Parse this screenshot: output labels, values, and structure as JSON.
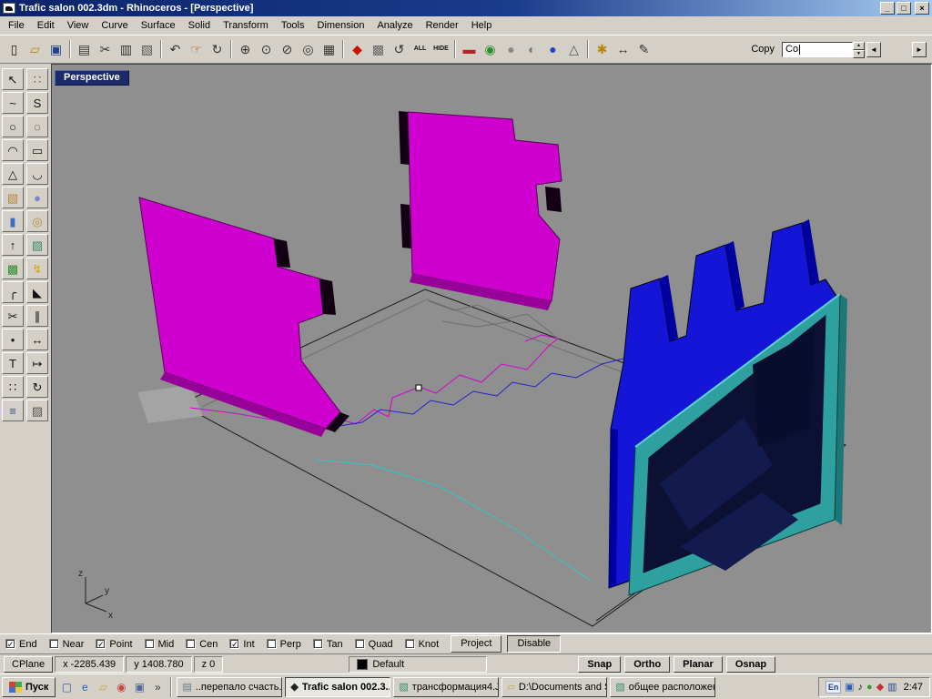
{
  "window": {
    "title": "Trafic salon 002.3dm - Rhinoceros - [Perspective]",
    "controls": {
      "minimize": "_",
      "maximize": "□",
      "close": "×"
    }
  },
  "menu": {
    "items": [
      "File",
      "Edit",
      "View",
      "Curve",
      "Surface",
      "Solid",
      "Transform",
      "Tools",
      "Dimension",
      "Analyze",
      "Render",
      "Help"
    ]
  },
  "toolbar": {
    "command_history": "Copy",
    "command_input": "Co",
    "spinner_up": "▲",
    "spinner_down": "▼",
    "prev_arrow": "◄",
    "next_arrow": "►",
    "icons": [
      {
        "name": "new-file-icon",
        "glyph": "▯",
        "color": "#222222"
      },
      {
        "name": "open-file-icon",
        "glyph": "▱",
        "color": "#b8860b"
      },
      {
        "name": "save-file-icon",
        "glyph": "▣",
        "color": "#27408b"
      },
      {
        "sep": true
      },
      {
        "name": "print-icon",
        "glyph": "▤",
        "color": "#333333"
      },
      {
        "name": "cut-icon",
        "glyph": "✂",
        "color": "#333333"
      },
      {
        "name": "copy-icon",
        "glyph": "▥",
        "color": "#333333"
      },
      {
        "name": "paste-icon",
        "glyph": "▧",
        "color": "#555555"
      },
      {
        "sep": true
      },
      {
        "name": "undo-icon",
        "glyph": "↶",
        "color": "#333333"
      },
      {
        "name": "pan-icon",
        "glyph": "☞",
        "color": "#a0622a"
      },
      {
        "name": "rotate-view-icon",
        "glyph": "↻",
        "color": "#333333"
      },
      {
        "sep": true
      },
      {
        "name": "zoom-in-icon",
        "glyph": "⊕",
        "color": "#333333"
      },
      {
        "name": "zoom-window-icon",
        "glyph": "⊙",
        "color": "#333333"
      },
      {
        "name": "zoom-dynamic-icon",
        "glyph": "⊘",
        "color": "#333333"
      },
      {
        "name": "zoom-extents-icon",
        "glyph": "◎",
        "color": "#333333"
      },
      {
        "name": "grid-icon",
        "glyph": "▦",
        "color": "#333333"
      },
      {
        "sep": true
      },
      {
        "name": "render-icon",
        "glyph": "◆",
        "color": "#cc1100"
      },
      {
        "name": "shade-icon",
        "glyph": "▩",
        "color": "#666666"
      },
      {
        "name": "spin-view-icon",
        "glyph": "↺",
        "color": "#333333"
      },
      {
        "name": "show-all-icon",
        "glyph": "ALL",
        "color": "#111111"
      },
      {
        "name": "hide-icon",
        "glyph": "HIDE",
        "color": "#111111"
      },
      {
        "sep": true
      },
      {
        "name": "render-settings-icon",
        "glyph": "▬",
        "color": "#bb2222"
      },
      {
        "name": "color-wheel-icon",
        "glyph": "◉",
        "color": "#2a8f2a"
      },
      {
        "name": "sphere-gray-icon",
        "glyph": "●",
        "color": "#8a8a8a"
      },
      {
        "name": "sphere-shaded-icon",
        "glyph": "◐",
        "color": "#777777"
      },
      {
        "name": "sphere-blue-icon",
        "glyph": "●",
        "color": "#2244cc"
      },
      {
        "name": "spotlight-icon",
        "glyph": "△",
        "color": "#555555"
      },
      {
        "sep": true
      },
      {
        "name": "options-icon",
        "glyph": "✱",
        "color": "#b8860b"
      },
      {
        "name": "measure-icon",
        "glyph": "↔",
        "color": "#333333"
      },
      {
        "name": "annotate-icon",
        "glyph": "✎",
        "color": "#333333"
      }
    ]
  },
  "sidebar": {
    "icons": [
      {
        "name": "selection-arrow-icon",
        "glyph": "↖",
        "color": "#111111"
      },
      {
        "name": "grip-dots-icon",
        "glyph": "∷",
        "color": "#555555"
      },
      {
        "name": "control-point-curve-icon",
        "glyph": "~",
        "color": "#111111"
      },
      {
        "name": "interpolate-curve-icon",
        "glyph": "S",
        "color": "#111111"
      },
      {
        "name": "circle-icon",
        "glyph": "○",
        "color": "#111111"
      },
      {
        "name": "ellipse-icon",
        "glyph": "◌",
        "color": "#111111"
      },
      {
        "name": "arc-icon",
        "glyph": "◠",
        "color": "#111111"
      },
      {
        "name": "rectangle-icon",
        "glyph": "▭",
        "color": "#111111"
      },
      {
        "name": "polygon-icon",
        "glyph": "△",
        "color": "#111111"
      },
      {
        "name": "freeform-curve-icon",
        "glyph": "◡",
        "color": "#111111"
      },
      {
        "name": "box-icon",
        "glyph": "▧",
        "color": "#b58a3a"
      },
      {
        "name": "sphere-icon",
        "glyph": "●",
        "color": "#7a86c8"
      },
      {
        "name": "cylinder-icon",
        "glyph": "▮",
        "color": "#3a6fc0"
      },
      {
        "name": "torus-icon",
        "glyph": "◎",
        "color": "#b58a3a"
      },
      {
        "name": "extrude-icon",
        "glyph": "↑",
        "color": "#111111"
      },
      {
        "name": "surface-icon",
        "glyph": "▨",
        "color": "#3a8a6a"
      },
      {
        "name": "planar-surface-icon",
        "glyph": "▩",
        "color": "#2f8f2f"
      },
      {
        "name": "explode-icon",
        "glyph": "↯",
        "color": "#d4a500"
      },
      {
        "name": "fillet-icon",
        "glyph": "╭",
        "color": "#111111"
      },
      {
        "name": "chamfer-icon",
        "glyph": "◣",
        "color": "#111111"
      },
      {
        "name": "trim-icon",
        "glyph": "✂",
        "color": "#111111"
      },
      {
        "name": "split-icon",
        "glyph": "∥",
        "color": "#111111"
      },
      {
        "name": "point-icon",
        "glyph": "•",
        "color": "#111111"
      },
      {
        "name": "move-icon",
        "glyph": "↔",
        "color": "#111111"
      },
      {
        "name": "text-icon",
        "glyph": "T",
        "color": "#111111"
      },
      {
        "name": "dimension-icon",
        "glyph": "↦",
        "color": "#111111"
      },
      {
        "name": "array-icon",
        "glyph": "∷",
        "color": "#111111"
      },
      {
        "name": "rotate-icon",
        "glyph": "↻",
        "color": "#111111"
      },
      {
        "name": "layers-icon",
        "glyph": "≡",
        "color": "#2a52be"
      },
      {
        "name": "hatch-icon",
        "glyph": "▨",
        "color": "#555555"
      }
    ]
  },
  "viewport": {
    "label": "Perspective",
    "axis_labels": {
      "x": "x",
      "y": "y",
      "z": "z"
    },
    "colors": {
      "background": "#8f8f8f",
      "magenta_panels": "#cf00cf",
      "blue_wall": "#1515d8",
      "teal_frame": "#2fa0a0",
      "panel_interior": "#0c1033"
    }
  },
  "osnap": {
    "items": [
      {
        "label": "End",
        "checked": true
      },
      {
        "label": "Near",
        "checked": false
      },
      {
        "label": "Point",
        "checked": true
      },
      {
        "label": "Mid",
        "checked": false
      },
      {
        "label": "Cen",
        "checked": false
      },
      {
        "label": "Int",
        "checked": true
      },
      {
        "label": "Perp",
        "checked": false
      },
      {
        "label": "Tan",
        "checked": false
      },
      {
        "label": "Quad",
        "checked": false
      },
      {
        "label": "Knot",
        "checked": false
      }
    ],
    "project": "Project",
    "disable": "Disable"
  },
  "status": {
    "cplane": "CPlane",
    "x": "x -2285.439",
    "y": "y 1408.780",
    "z": "z 0",
    "layer": "Default",
    "buttons": [
      "Snap",
      "Ortho",
      "Planar",
      "Osnap"
    ]
  },
  "taskbar": {
    "start": "Пуск",
    "quick_launch": [
      {
        "name": "ql-desktop-icon",
        "glyph": "▢",
        "color": "#2a5fbb"
      },
      {
        "name": "ql-ie-icon",
        "glyph": "e",
        "color": "#1a5fd0"
      },
      {
        "name": "ql-folder-icon",
        "glyph": "▱",
        "color": "#c9a23a"
      },
      {
        "name": "ql-media-icon",
        "glyph": "◉",
        "color": "#cc4444"
      },
      {
        "name": "ql-window-icon",
        "glyph": "▣",
        "color": "#556699"
      },
      {
        "name": "ql-more-icon",
        "glyph": "»",
        "color": "#333333"
      }
    ],
    "tasks": [
      {
        "name": "task-notepad",
        "label": "..перепало счасть...",
        "glyph": "▤",
        "color": "#667788",
        "active": false
      },
      {
        "name": "task-rhino",
        "label": "Trafic salon 002.3...",
        "glyph": "◆",
        "color": "#222222",
        "active": true
      },
      {
        "name": "task-image1",
        "label": "трансформация4.J...",
        "glyph": "▧",
        "color": "#2f8f6f",
        "active": false
      },
      {
        "name": "task-explorer",
        "label": "D:\\Documents and S...",
        "glyph": "▱",
        "color": "#c9a23a",
        "active": false
      },
      {
        "name": "task-image2",
        "label": "общее расположен...",
        "glyph": "▧",
        "color": "#2f8f6f",
        "active": false
      }
    ],
    "tray": {
      "language": "En",
      "icons": [
        {
          "name": "display-icon",
          "glyph": "▣",
          "color": "#2a5fbb"
        },
        {
          "name": "volume-icon",
          "glyph": "♪",
          "color": "#222222"
        },
        {
          "name": "antivirus-icon",
          "glyph": "●",
          "color": "#2f9e2f"
        },
        {
          "name": "scheduler-icon",
          "glyph": "◆",
          "color": "#c23333"
        },
        {
          "name": "network-icon",
          "glyph": "▥",
          "color": "#234a9a"
        }
      ],
      "clock": "2:47"
    }
  }
}
